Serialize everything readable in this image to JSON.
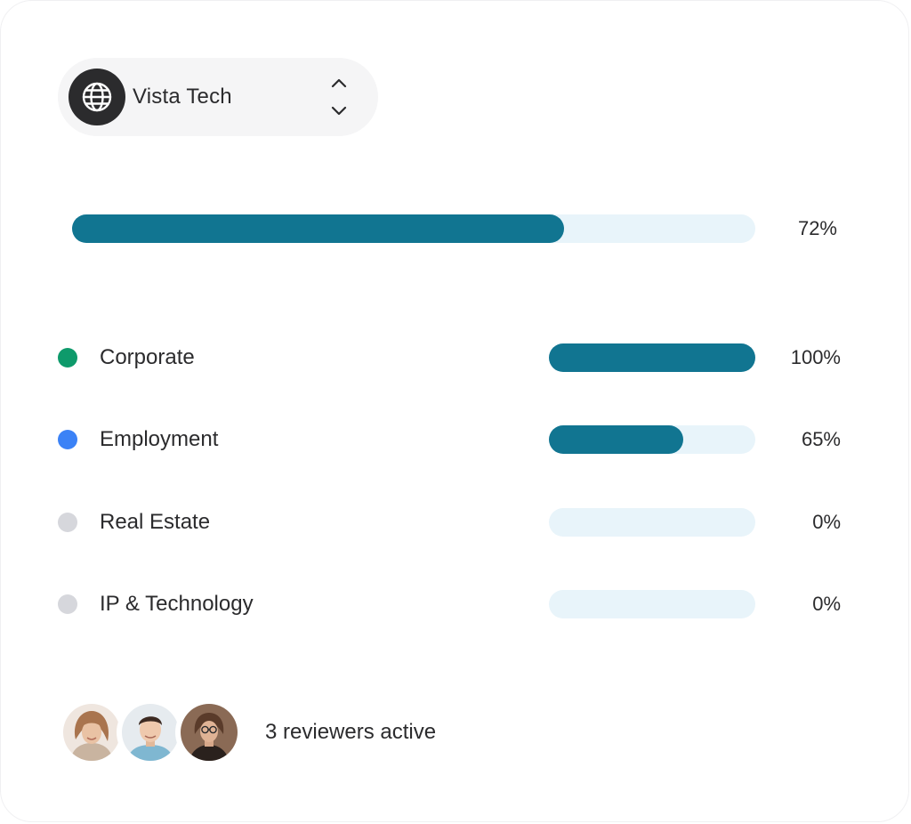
{
  "workspace": {
    "name": "Vista Tech",
    "icon": "globe-icon",
    "toggle_icon": "chevron-up-down-icon"
  },
  "overall": {
    "progress": 72,
    "label": "72%"
  },
  "categories": [
    {
      "label": "Corporate",
      "progress": 100,
      "pct": "100%",
      "dot_color": "#0e9a6b"
    },
    {
      "label": "Employment",
      "progress": 65,
      "pct": "65%",
      "dot_color": "#3b82f6"
    },
    {
      "label": "Real Estate",
      "progress": 0,
      "pct": "0%",
      "dot_color": "#d6d7dc"
    },
    {
      "label": "IP & Technology",
      "progress": 0,
      "pct": "0%",
      "dot_color": "#d6d7dc"
    }
  ],
  "reviewers": {
    "count_text": "3 reviewers active",
    "avatars": [
      "avatar-woman-blonde",
      "avatar-man-dark-hair",
      "avatar-woman-glasses"
    ]
  },
  "colors": {
    "bar_fill": "#117591",
    "bar_track": "#e8f4fa"
  }
}
